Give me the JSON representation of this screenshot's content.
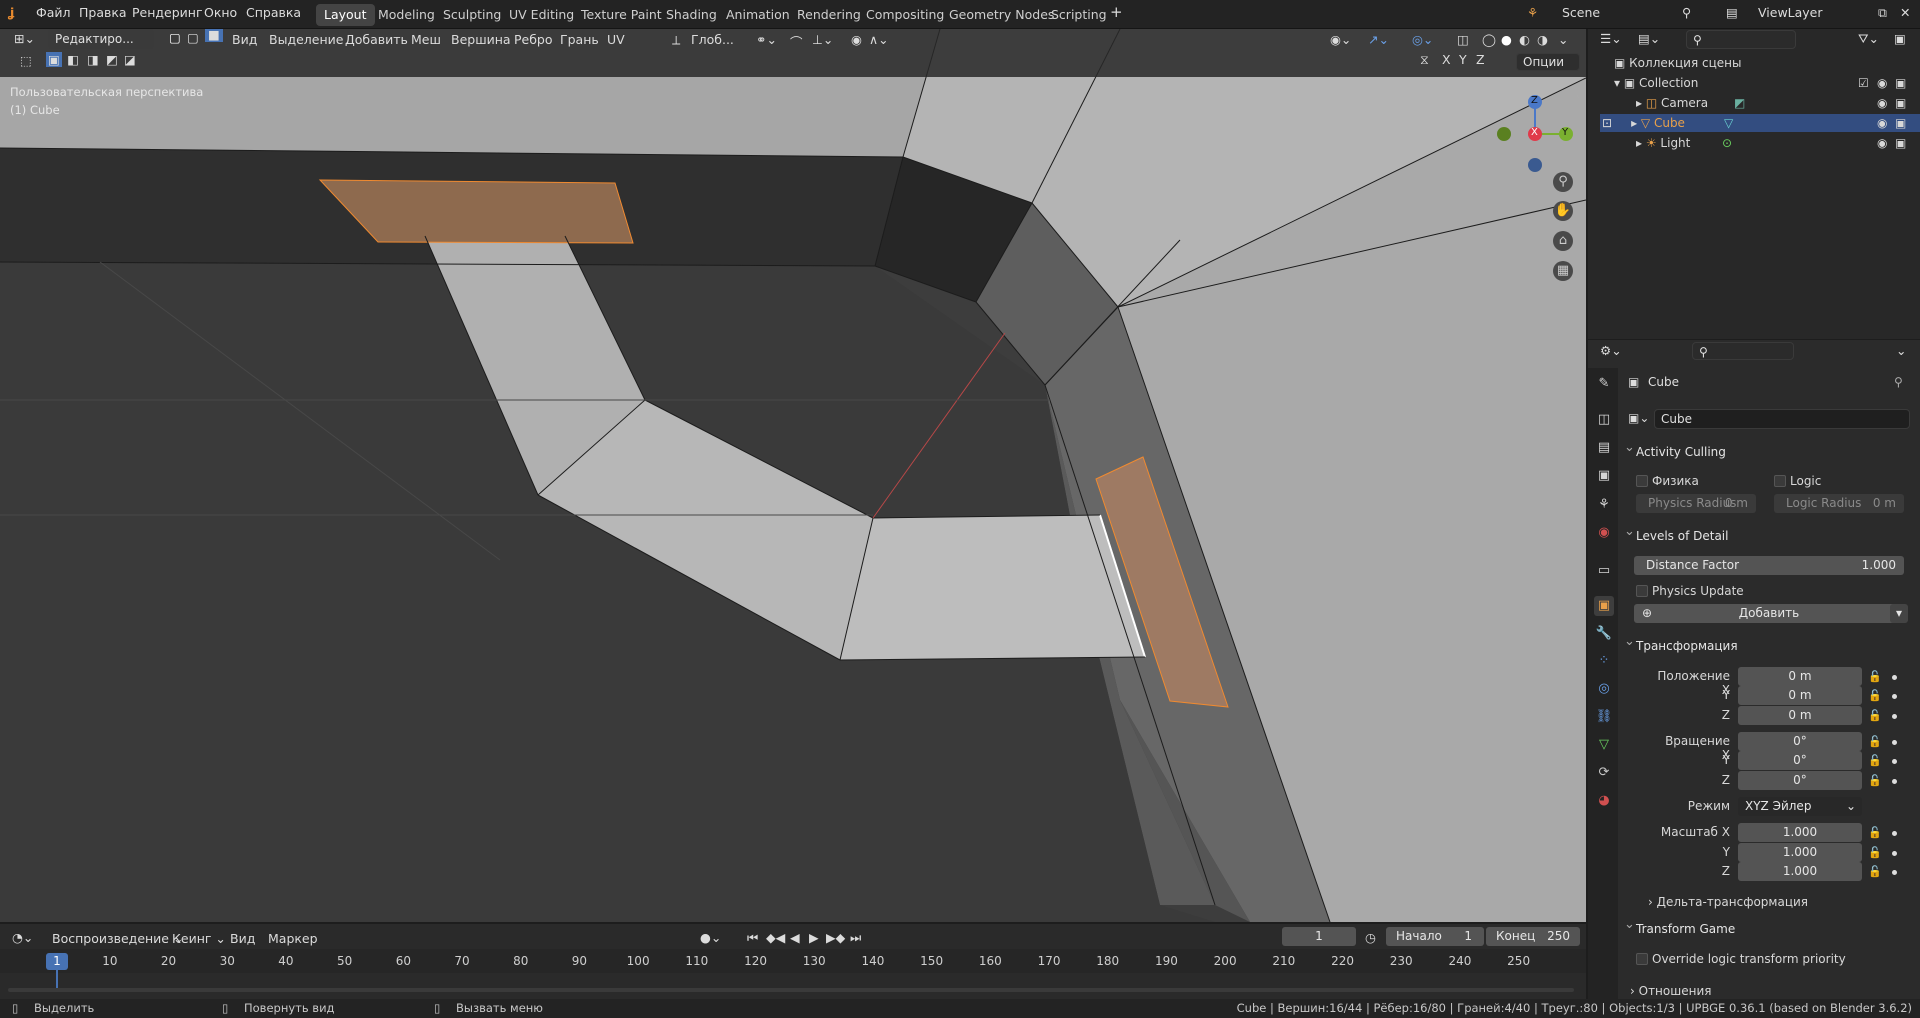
{
  "menu": {
    "file": "Файл",
    "edit": "Правка",
    "render": "Рендеринг",
    "window": "Окно",
    "help": "Справка"
  },
  "workspaces": [
    "Layout",
    "Modeling",
    "Sculpting",
    "UV Editing",
    "Texture Paint",
    "Shading",
    "Animation",
    "Rendering",
    "Compositing",
    "Geometry Nodes",
    "Scripting"
  ],
  "scene_name": "Scene",
  "view_layer": "ViewLayer",
  "viewport_header": {
    "mode": "Редактиро...",
    "view": "Вид",
    "select": "Выделение",
    "add": "Добавить",
    "mesh": "Меш",
    "vertex": "Вершина",
    "edge": "Ребро",
    "face": "Грань",
    "uv": "UV",
    "orientation": "Глоб...",
    "axes": [
      "X",
      "Y",
      "Z"
    ],
    "options": "Опции"
  },
  "viewport_info": {
    "perspective": "Пользовательская перспектива",
    "object": "(1) Cube"
  },
  "gizmo": {
    "z": "Z",
    "x": "X",
    "y": "Y"
  },
  "outliner": {
    "root": "Коллекция сцены",
    "collection": "Collection",
    "items": [
      {
        "name": "Camera",
        "color": "#e8a04a"
      },
      {
        "name": "Cube",
        "color": "#e8a04a"
      },
      {
        "name": "Light",
        "color": "#e8a04a"
      }
    ]
  },
  "properties": {
    "object_name": "Cube",
    "data_name": "Cube",
    "activity_culling": {
      "title": "Activity Culling",
      "physics": "Физика",
      "logic": "Logic",
      "physics_radius": "Physics Radius",
      "physics_radius_val": "0 m",
      "logic_radius": "Logic Radius",
      "logic_radius_val": "0 m"
    },
    "lod": {
      "title": "Levels of Detail",
      "distance_factor": "Distance Factor",
      "distance_factor_val": "1.000",
      "physics_update": "Physics Update",
      "add": "Добавить"
    },
    "transform": {
      "title": "Трансформация",
      "location": "Положение X",
      "loc": [
        "0 m",
        "0 m",
        "0 m"
      ],
      "rotation": "Вращение X",
      "rot": [
        "0°",
        "0°",
        "0°"
      ],
      "mode_label": "Режим",
      "mode": "XYZ Эйлер",
      "scale": "Масштаб X",
      "scl": [
        "1.000",
        "1.000",
        "1.000"
      ],
      "y": "Y",
      "z": "Z"
    },
    "delta": "Дельта-трансформация",
    "transform_game": {
      "title": "Transform Game",
      "override": "Override logic transform priority"
    },
    "relations": "Отношения"
  },
  "timeline": {
    "playback": "Воспроизведение",
    "keying": "Кеинг",
    "view": "Вид",
    "marker": "Маркер",
    "current_frame": "1",
    "start_label": "Начало",
    "start": "1",
    "end_label": "Конец",
    "end": "250",
    "ticks": [
      "1",
      "10",
      "20",
      "30",
      "40",
      "50",
      "60",
      "70",
      "80",
      "90",
      "100",
      "110",
      "120",
      "130",
      "140",
      "150",
      "160",
      "170",
      "180",
      "190",
      "200",
      "210",
      "220",
      "230",
      "240",
      "250"
    ]
  },
  "statusbar": {
    "select": "Выделить",
    "rotate": "Повернуть вид",
    "menu": "Вызвать меню",
    "stats": "Cube | Вершин:16/44 | Рёбер:16/80 | Граней:4/40 | Треуг.:80 | Objects:1/3 | UPBGE 0.36.1 (based on Blender 3.6.2)"
  }
}
